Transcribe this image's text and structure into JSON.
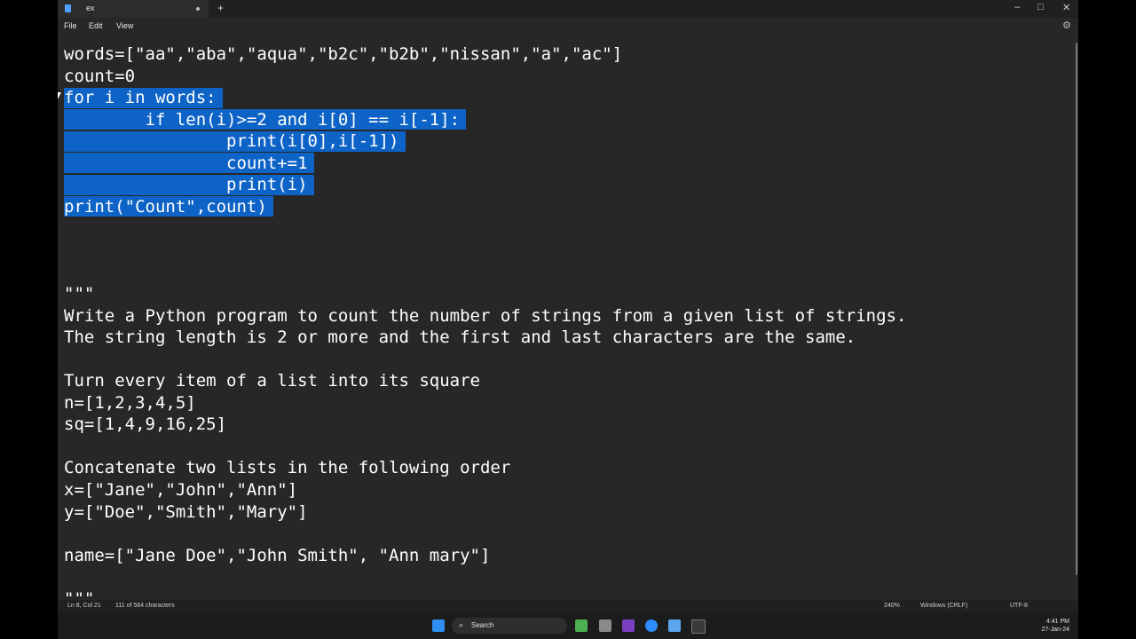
{
  "window": {
    "tab_title": "ex",
    "new_tab": "+",
    "minimize": "–",
    "maximize": "□",
    "close": "✕"
  },
  "menu": {
    "file": "File",
    "edit": "Edit",
    "view": "View"
  },
  "editor": {
    "lines": [
      "words=[\"aa\",\"aba\",\"aqua\",\"b2c\",\"b2b\",\"nissan\",\"a\",\"ac\"]",
      "count=0",
      "for i in words:",
      "        if len(i)>=2 and i[0] == i[-1]:",
      "                print(i[0],i[-1])",
      "                count+=1",
      "                print(i)",
      "print(\"Count\",count)",
      "",
      "",
      "",
      "\"\"\"",
      "Write a Python program to count the number of strings from a given list of strings.",
      "The string length is 2 or more and the first and last characters are the same.",
      "",
      "Turn every item of a list into its square",
      "n=[1,2,3,4,5]",
      "sq=[1,4,9,16,25]",
      "",
      "Concatenate two lists in the following order",
      "x=[\"Jane\",\"John\",\"Ann\"]",
      "y=[\"Doe\",\"Smith\",\"Mary\"]",
      "",
      "name=[\"Jane Doe\",\"John Smith\", \"Ann mary\"]",
      "",
      "\"\"\""
    ]
  },
  "status": {
    "position": "Ln 8, Col 21",
    "selection": "111 of 564 characters",
    "zoom": "240%",
    "line_ending": "Windows (CRLF)",
    "encoding": "UTF-8"
  },
  "taskbar": {
    "search_label": "Search",
    "time": "4:41 PM",
    "date": "27-Jan-24"
  },
  "colors": {
    "selection": "#0e63c7",
    "editor_bg": "#272727",
    "text": "#ffffff"
  }
}
